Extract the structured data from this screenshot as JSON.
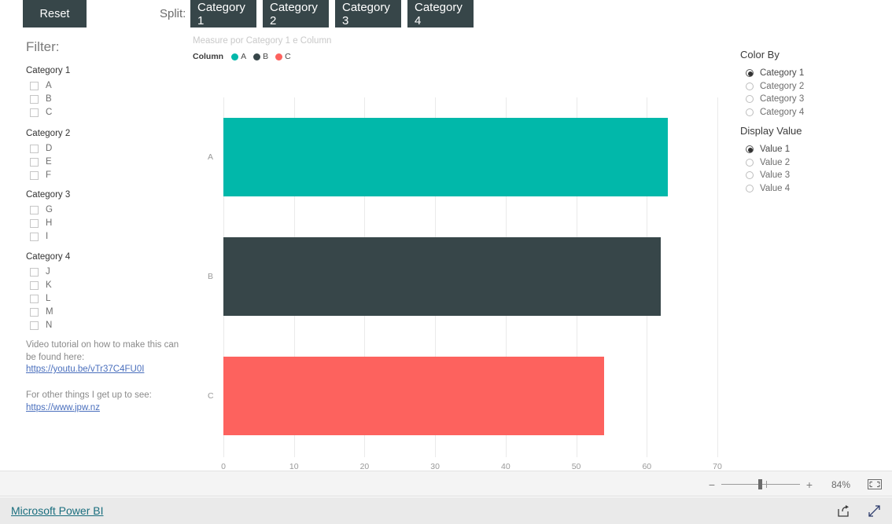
{
  "toolbar": {
    "reset_label": "Reset",
    "split_label": "Split:",
    "split_buttons": [
      {
        "label": "Category 1"
      },
      {
        "label": "Category 2"
      },
      {
        "label": "Category 3"
      },
      {
        "label": "Category 4"
      }
    ]
  },
  "filter": {
    "title": "Filter:",
    "groups": [
      {
        "title": "Category 1",
        "items": [
          {
            "label": "A"
          },
          {
            "label": "B"
          },
          {
            "label": "C"
          }
        ]
      },
      {
        "title": "Category 2",
        "items": [
          {
            "label": "D"
          },
          {
            "label": "E"
          },
          {
            "label": "F"
          }
        ]
      },
      {
        "title": "Category 3",
        "items": [
          {
            "label": "G"
          },
          {
            "label": "H"
          },
          {
            "label": "I"
          }
        ]
      },
      {
        "title": "Category 4",
        "items": [
          {
            "label": "J"
          },
          {
            "label": "K"
          },
          {
            "label": "L"
          },
          {
            "label": "M"
          },
          {
            "label": "N"
          }
        ]
      }
    ],
    "note_tutorial_line1": "Video tutorial on how to make this can",
    "note_tutorial_line2": "be found here:",
    "link_tutorial": "https://youtu.be/vTr37C4FU0I",
    "note_other": "For other things I get up to see:",
    "link_other": "https://www.jpw.nz"
  },
  "options": {
    "color_by_title": "Color By",
    "color_by": [
      {
        "label": "Category 1",
        "selected": true
      },
      {
        "label": "Category 2",
        "selected": false
      },
      {
        "label": "Category 3",
        "selected": false
      },
      {
        "label": "Category 4",
        "selected": false
      }
    ],
    "display_value_title": "Display Value",
    "display_value": [
      {
        "label": "Value 1",
        "selected": true
      },
      {
        "label": "Value 2",
        "selected": false
      },
      {
        "label": "Value 3",
        "selected": false
      },
      {
        "label": "Value 4",
        "selected": false
      }
    ]
  },
  "chart_data": {
    "type": "bar",
    "orientation": "horizontal",
    "title": "Measure por Category 1 e Column",
    "legend_title": "Column",
    "legend_position": "top-left",
    "categories": [
      "A",
      "B",
      "C"
    ],
    "values": [
      63,
      62,
      54
    ],
    "colors": [
      "#01b8aa",
      "#374649",
      "#fd625e"
    ],
    "series": [
      {
        "name": "A",
        "values": [
          63
        ],
        "color": "#01b8aa"
      },
      {
        "name": "B",
        "values": [
          62
        ],
        "color": "#374649"
      },
      {
        "name": "C",
        "values": [
          54
        ],
        "color": "#fd625e"
      }
    ],
    "xlabel": "",
    "ylabel": "",
    "xlim": [
      0,
      70
    ],
    "xticks": [
      0,
      10,
      20,
      30,
      40,
      50,
      60,
      70
    ],
    "grid": true
  },
  "statusbar": {
    "zoom_minus": "−",
    "zoom_plus": "+",
    "zoom_percent": "84%"
  },
  "footer": {
    "brand": "Microsoft Power BI"
  },
  "theme": {
    "dark": "#374649",
    "teal": "#01b8aa",
    "red": "#fd625e",
    "link": "#4a6fbd",
    "brand_link": "#1a6e7e"
  }
}
